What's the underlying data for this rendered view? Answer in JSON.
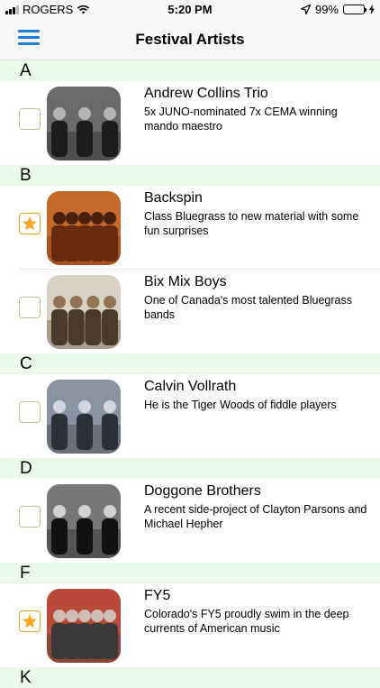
{
  "status_bar": {
    "carrier": "ROGERS",
    "time": "5:20 PM",
    "battery": "99%",
    "icons": [
      "signal-bars-icon",
      "wifi-icon",
      "location-arrow-icon",
      "battery-icon",
      "charging-bolt-icon"
    ]
  },
  "nav": {
    "title": "Festival Artists",
    "menu_icon": "hamburger-menu-icon",
    "accent": "#1f7de0"
  },
  "colors": {
    "section_header_bg": "#eafbe9",
    "checkbox_border": "#c3c19c",
    "star_fill": "#f5a623"
  },
  "sections": [
    {
      "letter": "A",
      "artists": [
        {
          "name": "Andrew Collins Trio",
          "description": "5x JUNO-nominated 7x CEMA winning mando maestro",
          "favorite": false
        }
      ]
    },
    {
      "letter": "B",
      "artists": [
        {
          "name": "Backspin",
          "description": "Class Bluegrass to new material with some fun surprises",
          "favorite": true
        },
        {
          "name": "Bix Mix Boys",
          "description": "One of Canada's most talented Bluegrass bands",
          "favorite": false
        }
      ]
    },
    {
      "letter": "C",
      "artists": [
        {
          "name": "Calvin Vollrath",
          "description": "He is the Tiger Woods of fiddle players",
          "favorite": false
        }
      ]
    },
    {
      "letter": "D",
      "artists": [
        {
          "name": "Doggone Brothers",
          "description": "A recent side-project of Clayton Parsons and Michael Hepher",
          "favorite": false
        }
      ]
    },
    {
      "letter": "F",
      "artists": [
        {
          "name": "FY5",
          "description": "Colorado's FY5 proudly swim in the deep currents of American music",
          "favorite": true
        }
      ]
    },
    {
      "letter": "K",
      "artists": []
    }
  ]
}
